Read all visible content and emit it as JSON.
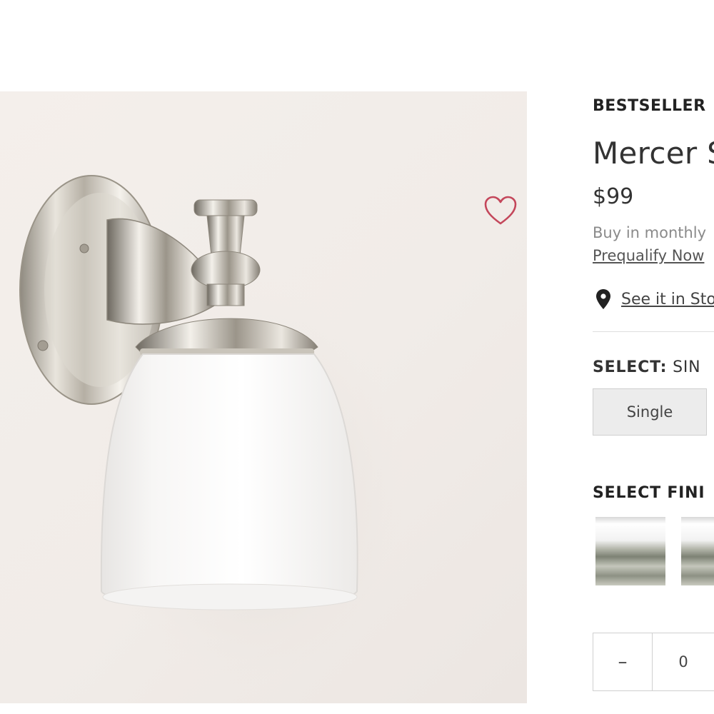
{
  "product": {
    "badge": "BESTSELLER",
    "title": "Mercer S",
    "price": "$99",
    "financing_text": "Buy in monthly",
    "prequalify_label": "Prequalify Now",
    "store_label": "See it in Sto",
    "store_icon": "location-pin-icon",
    "favorite_icon": "heart-icon",
    "accent_color": "#c4475b"
  },
  "select_size": {
    "label": "SELECT:",
    "value": "SIN",
    "options": [
      "Single"
    ]
  },
  "select_finish": {
    "label": "SELECT FINI",
    "swatch_icons": [
      "polished-nickel-swatch",
      "satin-nickel-swatch"
    ]
  },
  "quantity": {
    "decrement_label": "–",
    "value": "0"
  }
}
